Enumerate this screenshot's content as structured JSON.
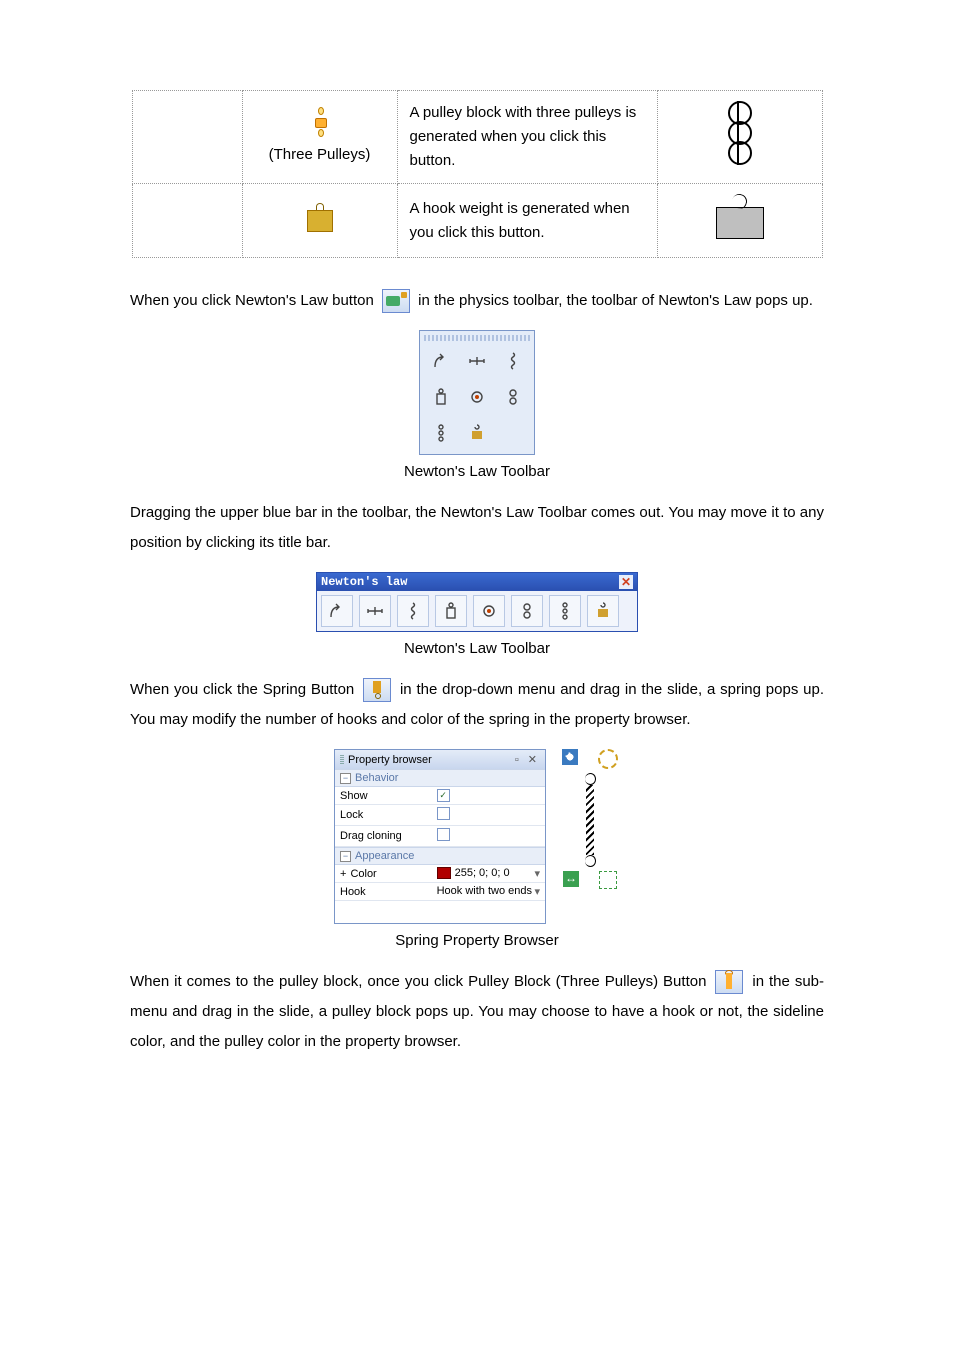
{
  "table": {
    "rows": [
      {
        "label": "(Three Pulleys)",
        "desc": "A pulley block with three pulleys is generated when you click this button."
      },
      {
        "label": "",
        "desc": "A hook weight is generated when you click this button."
      }
    ]
  },
  "paragraphs": {
    "p1a": "When you click Newton's Law button ",
    "p1b": " in the physics toolbar, the toolbar of Newton's Law pops up.",
    "caption1": "Newton's Law Toolbar",
    "p2": "Dragging the upper blue bar in the toolbar, the Newton's Law Toolbar comes out. You may move it to any position by clicking its title bar.",
    "wide_title": "Newton's law",
    "caption2": "Newton's Law Toolbar",
    "p3a": "When you click the Spring Button ",
    "p3b": " in the drop-down menu and drag in the slide, a spring pops up. You may modify the number of hooks and color of the spring in the property browser.",
    "caption3": "Spring Property Browser",
    "p4a": "When it comes to the pulley block, once you click Pulley Block (Three Pulleys) Button ",
    "p4b": " in the sub-menu and drag in the slide, a pulley block pops up. You may choose to have a hook or not, the sideline color, and the pulley color in the property browser."
  },
  "propertyBrowser": {
    "title": "Property browser",
    "controls": "▫ ✕",
    "section1": "Behavior",
    "rows1": [
      {
        "k": "Show",
        "v": "checked"
      },
      {
        "k": "Lock",
        "v": "unchecked"
      },
      {
        "k": "Drag cloning",
        "v": "unchecked"
      }
    ],
    "section2": "Appearance",
    "color_k": "Color",
    "color_v": "255; 0; 0; 0",
    "hook_k": "Hook",
    "hook_v": "Hook with two ends"
  }
}
